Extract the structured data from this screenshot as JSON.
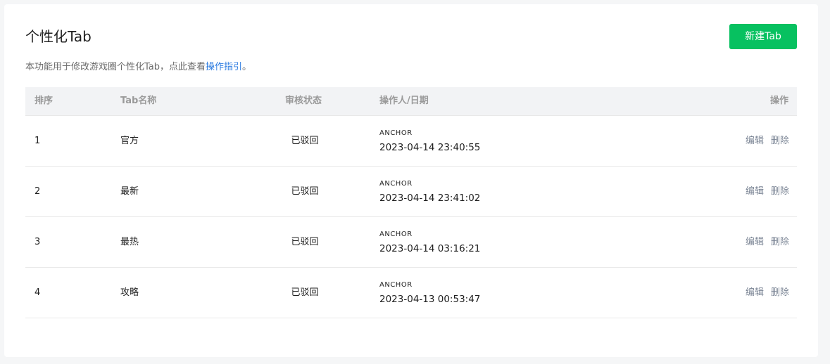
{
  "header": {
    "title": "个性化Tab",
    "create_button": "新建Tab"
  },
  "description": {
    "text": "本功能用于修改游戏圈个性化Tab，点此查看",
    "link": "操作指引",
    "suffix": "。"
  },
  "table": {
    "columns": [
      "排序",
      "Tab名称",
      "审核状态",
      "操作人/日期",
      "操作"
    ],
    "rows": [
      {
        "order": "1",
        "name": "官方",
        "status": "已驳回",
        "operator": "ANCHOR",
        "date": "2023-04-14 23:40:55",
        "edit": "编辑",
        "delete": "删除"
      },
      {
        "order": "2",
        "name": "最新",
        "status": "已驳回",
        "operator": "ANCHOR",
        "date": "2023-04-14 23:41:02",
        "edit": "编辑",
        "delete": "删除"
      },
      {
        "order": "3",
        "name": "最热",
        "status": "已驳回",
        "operator": "ANCHOR",
        "date": "2023-04-14 03:16:21",
        "edit": "编辑",
        "delete": "删除"
      },
      {
        "order": "4",
        "name": "攻略",
        "status": "已驳回",
        "operator": "ANCHOR",
        "date": "2023-04-13 00:53:47",
        "edit": "编辑",
        "delete": "删除"
      }
    ]
  },
  "colors": {
    "primary": "#07c160",
    "link": "#2f7de1"
  }
}
